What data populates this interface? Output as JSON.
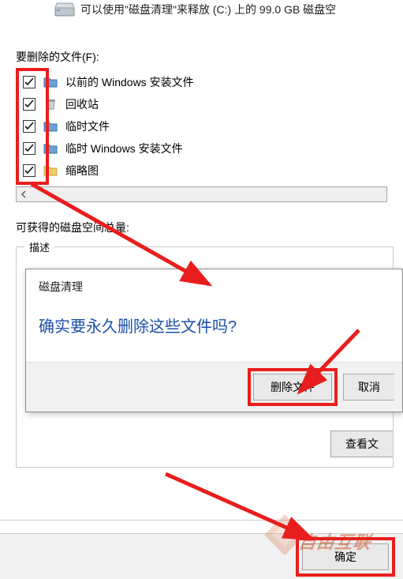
{
  "top": {
    "text_fragment": "可以使用\"磁盘清理\"来释放 (C:) 上的 99.0 GB 磁盘空"
  },
  "files_label": "要删除的文件(F):",
  "items": [
    {
      "label": "以前的 Windows 安装文件",
      "icon": "folder-blue",
      "checked": true
    },
    {
      "label": "回收站",
      "icon": "recycle-bin",
      "checked": true
    },
    {
      "label": "临时文件",
      "icon": "folder-blue",
      "checked": true
    },
    {
      "label": "临时 Windows 安装文件",
      "icon": "folder-blue",
      "checked": true
    },
    {
      "label": "缩略图",
      "icon": "folder-yellow",
      "checked": true
    }
  ],
  "space_label": "可获得的磁盘空间总量:",
  "description_group": "描述",
  "dialog": {
    "title": "磁盘清理",
    "message": "确实要永久删除这些文件吗?",
    "delete_btn": "删除文件",
    "cancel_btn": "取消"
  },
  "view_files_btn": "查看文",
  "ok_btn": "确定",
  "watermark": "自由互联"
}
